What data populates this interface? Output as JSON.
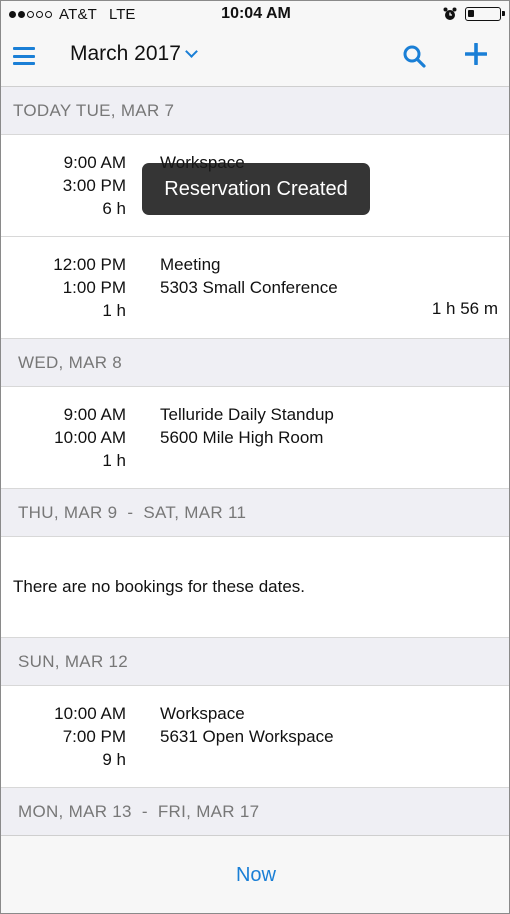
{
  "status_bar": {
    "carrier": "AT&T",
    "network": "LTE",
    "time": "10:04 AM",
    "signal_bars_filled": 2,
    "signal_bars_total": 5,
    "battery_level": 0.2
  },
  "nav": {
    "title": "March 2017",
    "icons": {
      "menu": "hamburger-menu-icon",
      "dropdown": "chevron-down-icon",
      "search": "search-icon",
      "add": "plus-icon"
    }
  },
  "toast": {
    "text": "Reservation Created"
  },
  "sections": [
    {
      "header": "TODAY TUE, MAR 7",
      "bookings": [
        {
          "start": "9:00 AM",
          "end": "3:00 PM",
          "duration": "6 h",
          "title": "Workspace",
          "location": "",
          "remaining": ""
        },
        {
          "start": "12:00 PM",
          "end": "1:00 PM",
          "duration": "1 h",
          "title": "Meeting",
          "location": "5303 Small Conference",
          "remaining": "1 h 56 m"
        }
      ]
    },
    {
      "header": "WED, MAR 8",
      "bookings": [
        {
          "start": "9:00 AM",
          "end": "10:00 AM",
          "duration": "1 h",
          "title": "Telluride Daily Standup",
          "location": "5600 Mile High Room",
          "remaining": ""
        }
      ]
    },
    {
      "header": "THU, MAR 9  -  SAT, MAR 11",
      "empty_text": "There are no bookings for these dates."
    },
    {
      "header": "SUN, MAR 12",
      "bookings": [
        {
          "start": "10:00 AM",
          "end": "7:00 PM",
          "duration": "9 h",
          "title": "Workspace",
          "location": "5631 Open Workspace",
          "remaining": ""
        }
      ]
    },
    {
      "header": "MON, MAR 13  -  FRI, MAR 17"
    }
  ],
  "bottom": {
    "now_label": "Now"
  },
  "colors": {
    "accent": "#1a7fd6",
    "section_bg": "#efeff4",
    "section_text": "#777777",
    "toast_bg": "#191919"
  }
}
